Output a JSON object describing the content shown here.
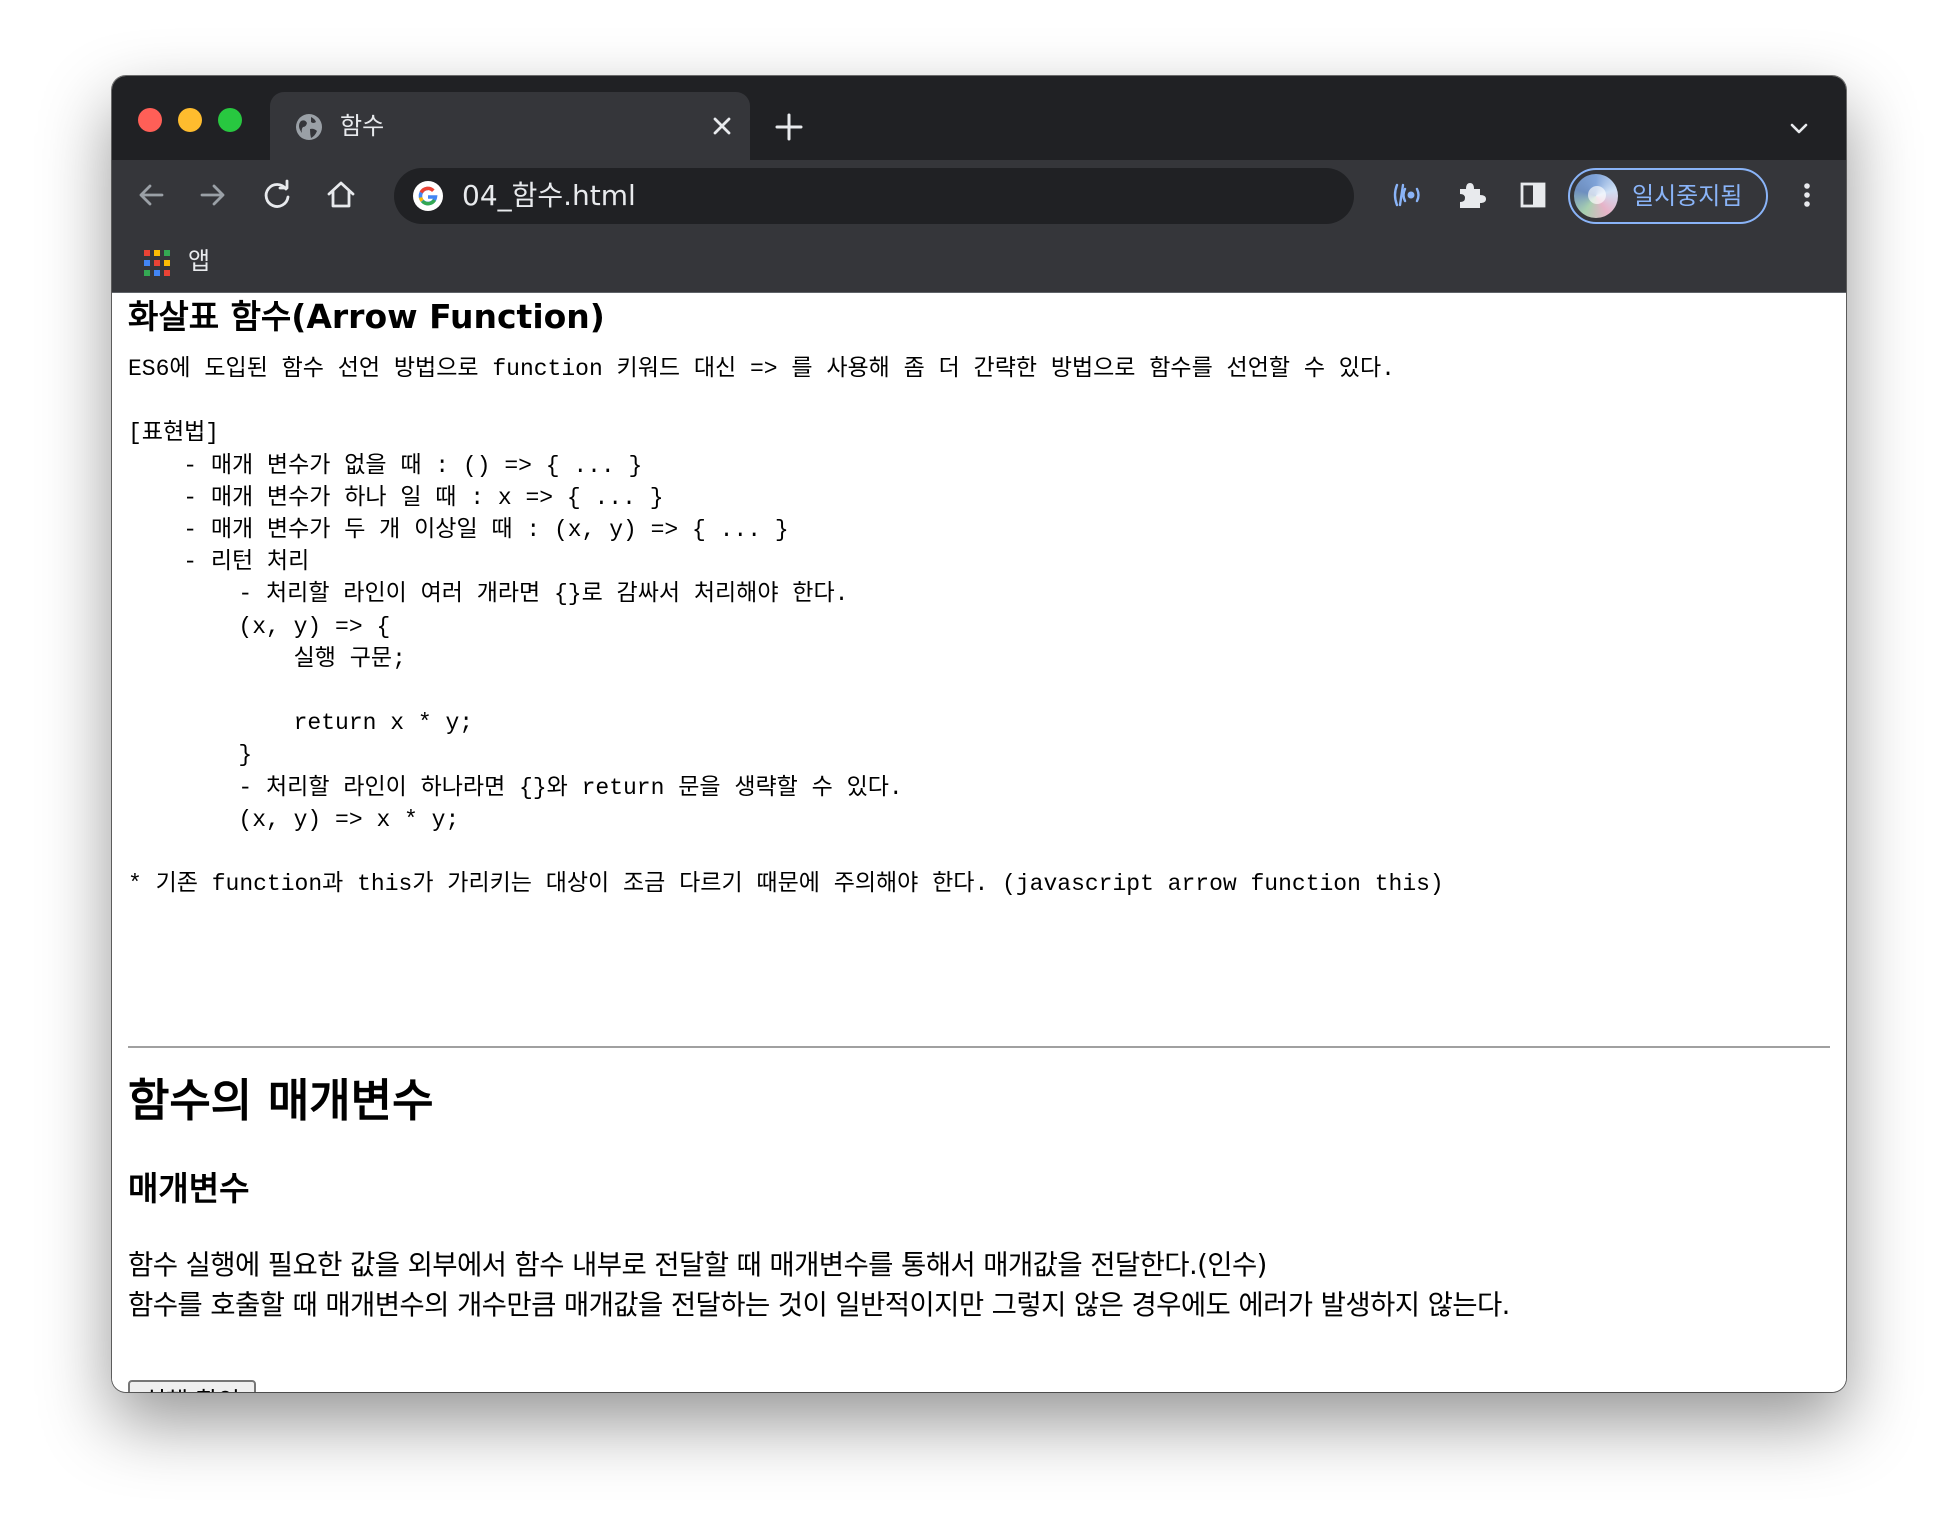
{
  "browser": {
    "tab": {
      "title": "함수"
    },
    "address_bar": {
      "url": "04_함수.html"
    },
    "profile": {
      "label": "일시중지됨"
    },
    "bookmarks": [
      {
        "label": "앱",
        "icon": "apps-grid-icon"
      }
    ],
    "icons": [
      "globe-icon",
      "close-icon",
      "plus-icon",
      "chevron-down-icon",
      "back-arrow-icon",
      "forward-arrow-icon",
      "reload-icon",
      "home-icon",
      "google-icon",
      "cast-icon",
      "puzzle-extensions-icon",
      "side-panel-icon",
      "kebab-menu-icon"
    ],
    "colors": {
      "tabstrip_bg": "#202124",
      "toolbar_bg": "#35363a",
      "accent": "#8ab4f8"
    }
  },
  "page": {
    "arrow_section": {
      "heading": "화살표 함수(Arrow Function)",
      "code_lines": [
        "ES6에 도입된 함수 선언 방법으로 function 키워드 대신 => 를 사용해 좀 더 간략한 방법으로 함수를 선언할 수 있다.",
        "",
        "[표현법]",
        "    - 매개 변수가 없을 때 : () => { ... }",
        "    - 매개 변수가 하나 일 때 : x => { ... }",
        "    - 매개 변수가 두 개 이상일 때 : (x, y) => { ... }",
        "    - 리턴 처리",
        "        - 처리할 라인이 여러 개라면 {}로 감싸서 처리해야 한다.",
        "        (x, y) => {",
        "            실행 구문;",
        "",
        "            return x * y;",
        "        }",
        "        - 처리할 라인이 하나라면 {}와 return 문을 생략할 수 있다.",
        "        (x, y) => x * y;",
        "",
        "* 기존 function과 this가 가리키는 대상이 조금 다르기 때문에 주의해야 한다. (javascript arrow function this)"
      ]
    },
    "params_section": {
      "title": "함수의 매개변수",
      "subtitle": "매개변수",
      "paragraph_lines": [
        "함수 실행에 필요한 값을 외부에서 함수 내부로 전달할 때 매개변수를 통해서 매개값을 전달한다.(인수)",
        "함수를 호출할 때 매개변수의 개수만큼 매개값을 전달하는 것이 일반적이지만 그렇지 않은 경우에도 에러가 발생하지 않는다."
      ],
      "button_label": "실행 확인"
    }
  }
}
